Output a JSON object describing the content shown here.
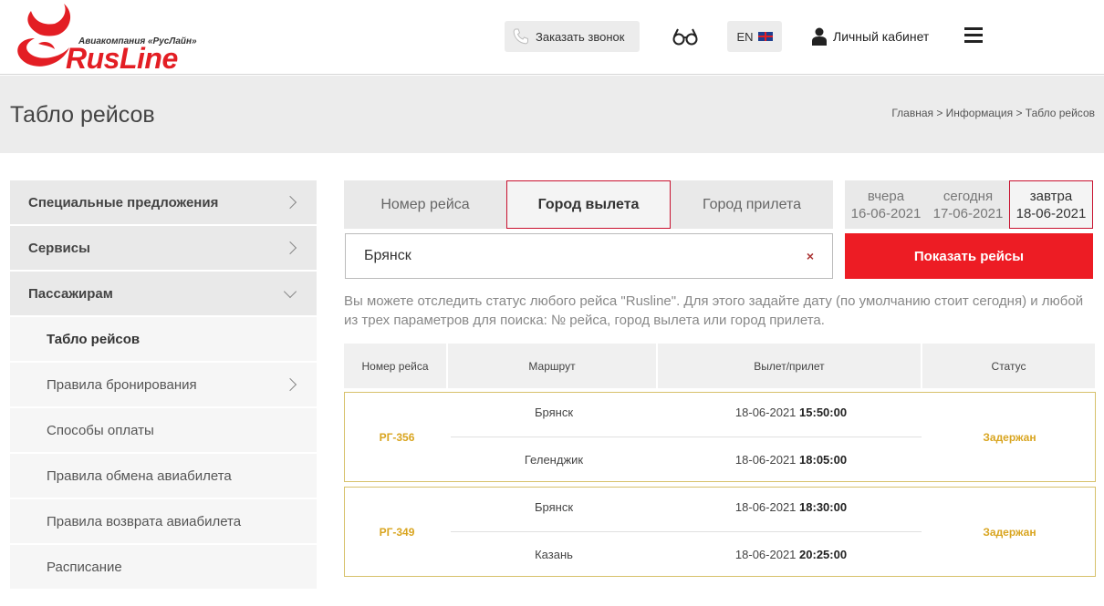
{
  "header": {
    "logo_tagline": "Авиакомпания «РусЛайн»",
    "logo_word": "RusLine",
    "call_label": "Заказать звонок",
    "lang_label": "EN",
    "cabinet_label": "Личный кабинет",
    "icons": [
      "phone-icon",
      "glasses-icon",
      "uk-flag-icon",
      "user-icon",
      "menu-icon"
    ]
  },
  "titlebar": {
    "title": "Табло рейсов",
    "breadcrumb": "Главная > Информация > Табло рейсов"
  },
  "sidebar": {
    "items": [
      {
        "label": "Специальные предложения"
      },
      {
        "label": "Сервисы"
      },
      {
        "label": "Пассажирам"
      },
      {
        "label": "Табло рейсов"
      },
      {
        "label": "Правила бронирования"
      },
      {
        "label": "Способы оплаты"
      },
      {
        "label": "Правила обмена авиабилета"
      },
      {
        "label": "Правила возврата авиабилета"
      },
      {
        "label": "Расписание"
      }
    ]
  },
  "search": {
    "tabs": [
      "Номер рейса",
      "Город вылета",
      "Город прилета"
    ],
    "active_tab": "Город вылета",
    "dates": [
      {
        "word": "вчера",
        "date": "16-06-2021"
      },
      {
        "word": "сегодня",
        "date": "17-06-2021"
      },
      {
        "word": "завтра",
        "date": "18-06-2021"
      }
    ],
    "active_date": "завтра",
    "input_value": "Брянск",
    "clear_symbol": "×",
    "button_label": "Показать рейсы",
    "hint": "Вы можете отследить статус любого рейса \"Rusline\". Для этого задайте дату (по умолчанию стоит сегодня) и любой из трех параметров для поиска: № рейса, город вылета или город прилета."
  },
  "table": {
    "headers": [
      "Номер рейса",
      "Маршрут",
      "Вылет/прилет",
      "Статус"
    ],
    "rows": [
      {
        "flight": "РГ-356",
        "from": "Брянск",
        "to": "Геленджик",
        "dep_date": "18-06-2021",
        "dep_time": "15:50:00",
        "arr_date": "18-06-2021",
        "arr_time": "18:05:00",
        "status": "Задержан"
      },
      {
        "flight": "РГ-349",
        "from": "Брянск",
        "to": "Казань",
        "dep_date": "18-06-2021",
        "dep_time": "18:30:00",
        "arr_date": "18-06-2021",
        "arr_time": "20:25:00",
        "status": "Задержан"
      }
    ]
  },
  "colors": {
    "brand_red": "#ed1c24",
    "status_gold": "#d9a520",
    "active_border": "#c8102e"
  }
}
